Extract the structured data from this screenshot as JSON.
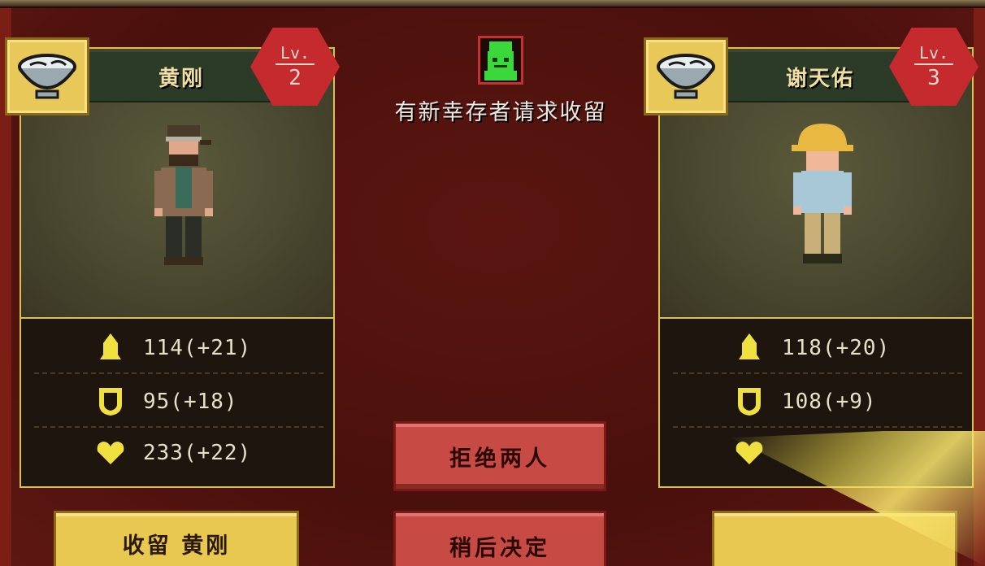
{
  "survivors": [
    {
      "name": "黄刚",
      "level_label": "Lv.",
      "level": "2",
      "stats": [
        {
          "icon": "attack-icon",
          "text": "114(+21)"
        },
        {
          "icon": "shield-icon",
          "text": "95(+18)"
        },
        {
          "icon": "heart-icon",
          "text": "233(+22)"
        }
      ],
      "accept_label": "收留 黄刚"
    },
    {
      "name": "谢天佑",
      "level_label": "Lv.",
      "level": "3",
      "stats": [
        {
          "icon": "attack-icon",
          "text": "118(+20)"
        },
        {
          "icon": "shield-icon",
          "text": "108(+9)"
        },
        {
          "icon": "heart-icon",
          "text": ""
        }
      ],
      "accept_label": ""
    }
  ],
  "request": {
    "icon": "survivor-face-icon",
    "text": "有新幸存者请求收留"
  },
  "actions": {
    "reject_label": "拒绝两人",
    "later_label": "稍后决定"
  },
  "colors": {
    "background": "#5a1510",
    "gold": "#d8c24a",
    "red_button": "#c84a44",
    "yellow_button": "#e8c850",
    "level_badge": "#c42a2e"
  }
}
